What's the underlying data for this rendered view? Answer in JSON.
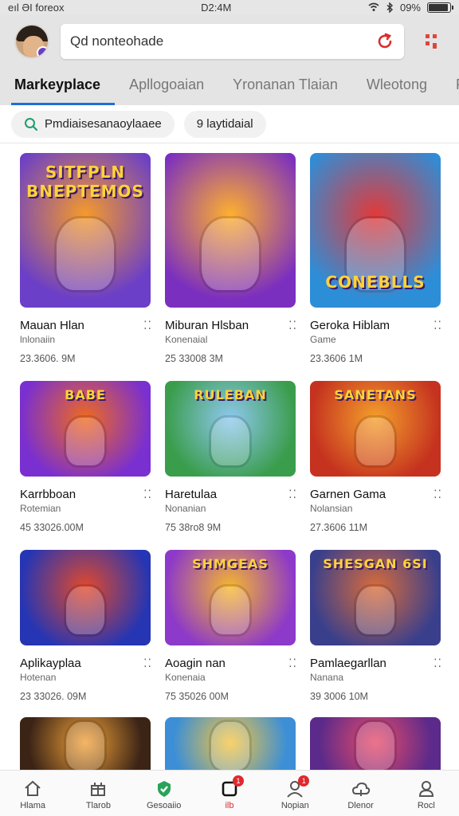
{
  "status_bar": {
    "left_text": "eıl ƏI foreox",
    "time": "D2:4M",
    "battery_text": "09%",
    "battery_level": 0.92
  },
  "header": {
    "search_value": "Qd nonteohade",
    "tabs": [
      {
        "label": "Markeyplace",
        "active": true
      },
      {
        "label": "Apllogoaian",
        "active": false
      },
      {
        "label": "Yronanan Tlaian",
        "active": false
      },
      {
        "label": "Wleotong",
        "active": false
      },
      {
        "label": "Pa",
        "active": false
      }
    ]
  },
  "filters": [
    {
      "label": "Pmdiaisesanaoylaaee",
      "icon": "search-icon"
    },
    {
      "label": "9 laytidaial",
      "icon": ""
    }
  ],
  "cards": [
    {
      "title": "Mauan Hlan",
      "sub": "lnlonaiin",
      "meta": "23.3606. 9M",
      "art": "SITFPLN BNEPTEMOS",
      "colors": [
        "#6b3fc7",
        "#f59a2b"
      ]
    },
    {
      "title": "Miburan Hlsban",
      "sub": "Konenaial",
      "meta": "25 33008 3M",
      "art": "",
      "colors": [
        "#7b2fbf",
        "#ffb02e"
      ]
    },
    {
      "title": "Geroka Hiblam",
      "sub": "Game",
      "meta": "23.3606 1M",
      "art": "CONEBLLS",
      "colors": [
        "#2d8ed8",
        "#e23a3a"
      ]
    },
    {
      "title": "Karrbboan",
      "sub": "Rotemian",
      "meta": "45 33026.00M",
      "art": "BABE",
      "colors": [
        "#7a2fd0",
        "#f06a1f"
      ]
    },
    {
      "title": "Haretulaa",
      "sub": "Nonanian",
      "meta": "75 38ro8 9M",
      "art": "RULEBAN",
      "colors": [
        "#3a9d4c",
        "#8fc8f0"
      ]
    },
    {
      "title": "Garnen Gama",
      "sub": "Nolansian",
      "meta": "27.3606 11M",
      "art": "SANETANS",
      "colors": [
        "#c5321f",
        "#f4a02c"
      ]
    },
    {
      "title": "Aplikayplaa",
      "sub": "Hotenan",
      "meta": "23 33026. 09M",
      "art": "",
      "colors": [
        "#2535b4",
        "#e2492b"
      ]
    },
    {
      "title": "Aoagin nan",
      "sub": "Konenaia",
      "meta": "75 35026 00M",
      "art": "SHMGEAS",
      "colors": [
        "#8d39c9",
        "#f7b82c"
      ]
    },
    {
      "title": "Pamlaegarllan",
      "sub": "Nanana",
      "meta": "39 3006 10M",
      "art": "SHESGAN 6SI",
      "colors": [
        "#3a3f8c",
        "#d96c3a"
      ]
    },
    {
      "title": "",
      "sub": "",
      "meta": "",
      "art": "",
      "colors": [
        "#3b2416",
        "#f2a23a"
      ]
    },
    {
      "title": "",
      "sub": "",
      "meta": "",
      "art": "",
      "colors": [
        "#3c8fd6",
        "#f6c540"
      ]
    },
    {
      "title": "",
      "sub": "",
      "meta": "",
      "art": "",
      "colors": [
        "#5b2a8a",
        "#e84b6a"
      ]
    }
  ],
  "bottom_nav": [
    {
      "label": "Hlama",
      "icon": "home-icon",
      "badge": ""
    },
    {
      "label": "Tlarob",
      "icon": "gift-icon",
      "badge": ""
    },
    {
      "label": "Gesoaiio",
      "icon": "shield-check-icon",
      "badge": ""
    },
    {
      "label": "ilb",
      "icon": "square-icon",
      "badge": "1",
      "active": true
    },
    {
      "label": "Nopian",
      "icon": "user-icon",
      "badge": "1"
    },
    {
      "label": "Dlenor",
      "icon": "cloud-icon",
      "badge": ""
    },
    {
      "label": "Rocl",
      "icon": "profile-icon",
      "badge": ""
    }
  ]
}
